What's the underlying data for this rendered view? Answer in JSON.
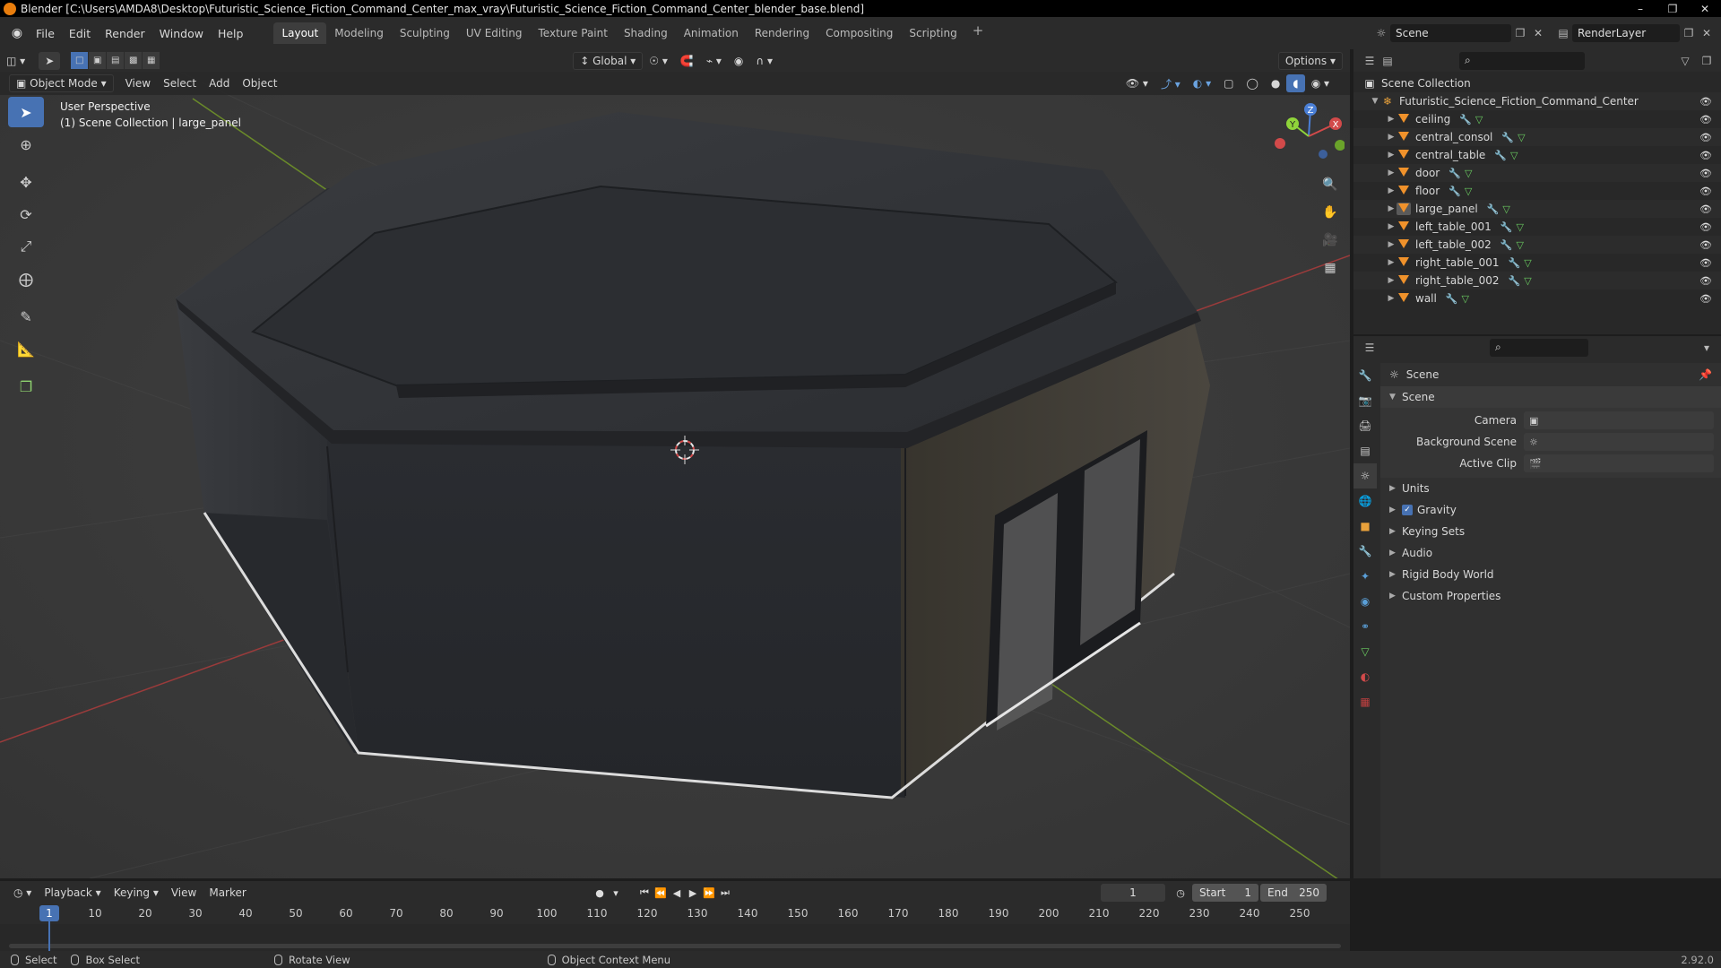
{
  "window": {
    "title": "Blender [C:\\Users\\AMDA8\\Desktop\\Futuristic_Science_Fiction_Command_Center_max_vray\\Futuristic_Science_Fiction_Command_Center_blender_base.blend]",
    "minimize": "–",
    "maximize": "❐",
    "close": "✕"
  },
  "menu": [
    "File",
    "Edit",
    "Render",
    "Window",
    "Help"
  ],
  "workspaces": [
    "Layout",
    "Modeling",
    "Sculpting",
    "UV Editing",
    "Texture Paint",
    "Shading",
    "Animation",
    "Rendering",
    "Compositing",
    "Scripting"
  ],
  "active_workspace": "Layout",
  "scene_name": "Scene",
  "render_layer": "RenderLayer",
  "viewport": {
    "mode": "Object Mode",
    "menus": [
      "View",
      "Select",
      "Add",
      "Object"
    ],
    "orientation": "Global",
    "options": "Options",
    "info_line1": "User Perspective",
    "info_line2": "(1) Scene Collection | large_panel",
    "gizmo": {
      "x": "X",
      "y": "Y",
      "z": "Z"
    }
  },
  "outliner": {
    "root": "Scene Collection",
    "collection": "Futuristic_Science_Fiction_Command_Center",
    "objects": [
      "ceiling",
      "central_consol",
      "central_table",
      "door",
      "floor",
      "large_panel",
      "left_table_001",
      "left_table_002",
      "right_table_001",
      "right_table_002",
      "wall"
    ]
  },
  "properties": {
    "context": "Scene",
    "section": "Scene",
    "fields": [
      {
        "label": "Camera",
        "value": ""
      },
      {
        "label": "Background Scene",
        "value": ""
      },
      {
        "label": "Active Clip",
        "value": ""
      }
    ],
    "panels": [
      "Units",
      "Gravity",
      "Keying Sets",
      "Audio",
      "Rigid Body World",
      "Custom Properties"
    ]
  },
  "timeline": {
    "menus": [
      "Playback",
      "Keying",
      "View",
      "Marker"
    ],
    "current_frame": "1",
    "start_label": "Start",
    "start": "1",
    "end_label": "End",
    "end": "250",
    "ticks": [
      "10",
      "20",
      "30",
      "40",
      "50",
      "60",
      "70",
      "80",
      "90",
      "100",
      "110",
      "120",
      "130",
      "140",
      "150",
      "160",
      "170",
      "180",
      "190",
      "200",
      "210",
      "220",
      "230",
      "240",
      "250"
    ]
  },
  "statusbar": {
    "select": "Select",
    "box_select": "Box Select",
    "rotate": "Rotate View",
    "context_menu": "Object Context Menu",
    "version": "2.92.0"
  }
}
